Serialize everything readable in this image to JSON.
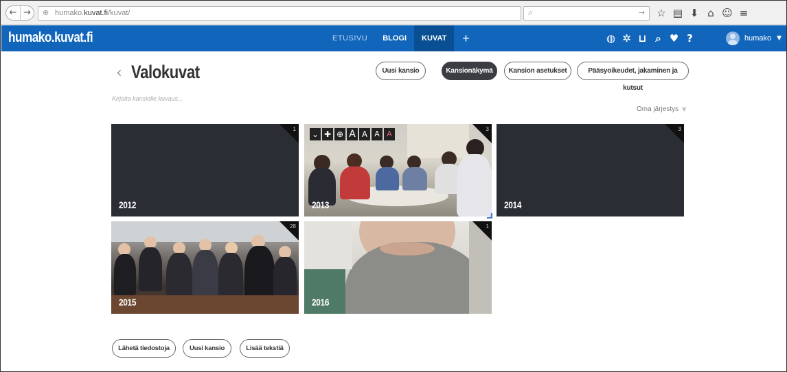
{
  "browser": {
    "url_prefix": "humako.",
    "url_domain": "kuvat.fi",
    "url_path": "/kuvat/",
    "reload_icon": "reload-icon",
    "search_icon": "search-icon"
  },
  "header": {
    "logo": "humako.kuvat.fi",
    "nav": [
      {
        "label": "ETUSIVU"
      },
      {
        "label": "BLOGI"
      },
      {
        "label": "KUVAT"
      },
      {
        "label": "+"
      }
    ],
    "active_nav": "KUVAT",
    "icons": [
      "globe-icon",
      "gear-icon",
      "cart-icon",
      "search-icon",
      "heart-icon",
      "help-icon"
    ],
    "user_name": "humako",
    "brand_color": "#1166bb"
  },
  "page": {
    "back": "‹",
    "title": "Valokuvat",
    "description_placeholder": "Kirjoita kansiolle kuvaus...",
    "sort_label": "Oma järjestys",
    "top_buttons": {
      "new_folder": "Uusi kansio",
      "folder_view": "Kansionäkymä",
      "folder_settings": "Kansion asetukset",
      "access_rights": "Pääsyoikeudet, jakaminen ja kutsut"
    },
    "folders": [
      {
        "name": "2012",
        "count": "1"
      },
      {
        "name": "2013",
        "count": "3"
      },
      {
        "name": "2014",
        "count": "3"
      },
      {
        "name": "2015",
        "count": "28"
      },
      {
        "name": "2016",
        "count": "1"
      }
    ],
    "image_toolbar": {
      "collapse": "⌄",
      "move": "✚",
      "zoom": "⊕",
      "font_a1": "A",
      "font_a2": "A",
      "font_a3": "A",
      "font_a4": "A"
    },
    "bottom_buttons": {
      "upload": "Lähetä tiedostoja",
      "new_folder": "Uusi kansio",
      "add_text": "Lisää tekstiä"
    }
  }
}
